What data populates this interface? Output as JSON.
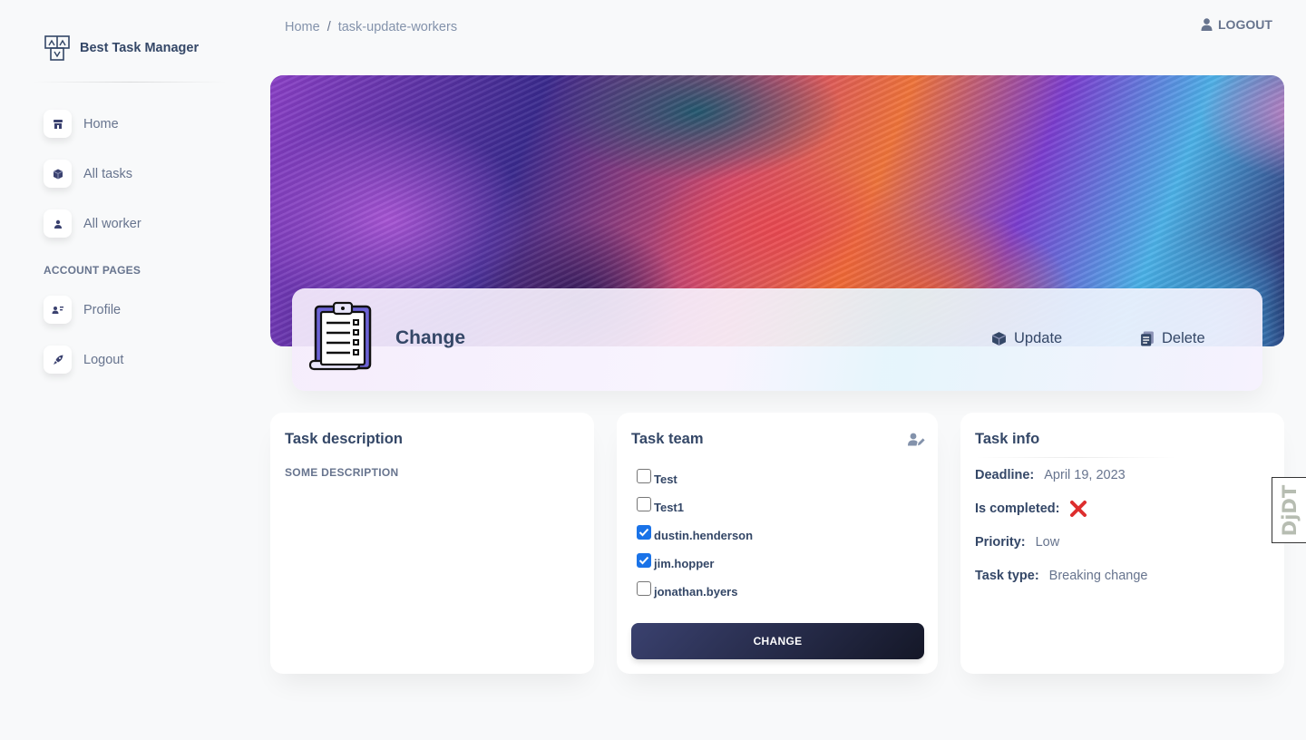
{
  "brand": {
    "name": "Best Task Manager"
  },
  "sidebar": {
    "items": [
      {
        "label": "Home",
        "icon": "shop-icon"
      },
      {
        "label": "All tasks",
        "icon": "box-icon"
      },
      {
        "label": "All worker",
        "icon": "user-icon"
      }
    ],
    "section_title": "ACCOUNT PAGES",
    "account_items": [
      {
        "label": "Profile",
        "icon": "user-card-icon"
      },
      {
        "label": "Logout",
        "icon": "rocket-icon"
      }
    ]
  },
  "breadcrumb": {
    "home": "Home",
    "separator": "/",
    "current": "task-update-workers"
  },
  "topbar": {
    "logout_label": "LOGOUT"
  },
  "header": {
    "title": "Change",
    "update_label": "Update",
    "delete_label": "Delete"
  },
  "description_card": {
    "title": "Task description",
    "text": "SOME DESCRIPTION"
  },
  "team_card": {
    "title": "Task team",
    "workers": [
      {
        "name": "Test",
        "checked": false
      },
      {
        "name": "Test1",
        "checked": false
      },
      {
        "name": "dustin.henderson",
        "checked": true
      },
      {
        "name": "jim.hopper",
        "checked": true
      },
      {
        "name": "jonathan.byers",
        "checked": false
      }
    ],
    "button_label": "CHANGE"
  },
  "info_card": {
    "title": "Task info",
    "deadline_label": "Deadline:",
    "deadline_value": "April 19, 2023",
    "completed_label": "Is completed:",
    "completed_icon": "cross-mark-icon",
    "priority_label": "Priority:",
    "priority_value": "Low",
    "type_label": "Task type:",
    "type_value": "Breaking change"
  },
  "debug_toolbar": {
    "label": "DjDT"
  },
  "colors": {
    "primary_text": "#344767",
    "secondary_text": "#67748e",
    "checkbox_checked": "#1a73e8",
    "cross_red": "#dd2e2e",
    "button_dark_start": "#3a416f",
    "button_dark_end": "#141727"
  }
}
